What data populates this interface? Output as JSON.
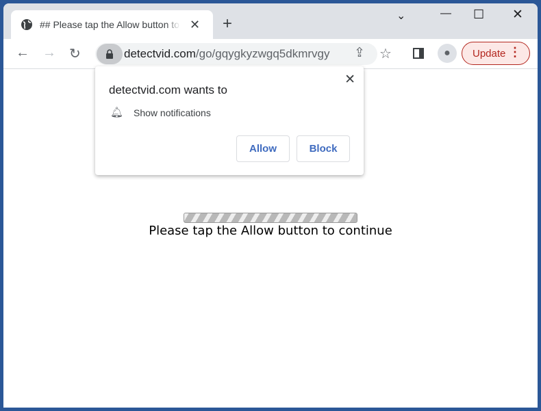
{
  "tab": {
    "title": "## Please tap the Allow button to continue",
    "icon": "globe-icon"
  },
  "address": {
    "domain": "detectvid.com",
    "path": "/go/gqygkyzwgq5dkmrvgy"
  },
  "update_label": "Update",
  "popup": {
    "heading": "detectvid.com wants to",
    "permission": "Show notifications",
    "allow": "Allow",
    "block": "Block"
  },
  "page": {
    "message": "Please tap the Allow button to continue"
  },
  "colors": {
    "frame": "#2b5797",
    "accent": "#3f6bbf",
    "update": "#b3261e"
  }
}
